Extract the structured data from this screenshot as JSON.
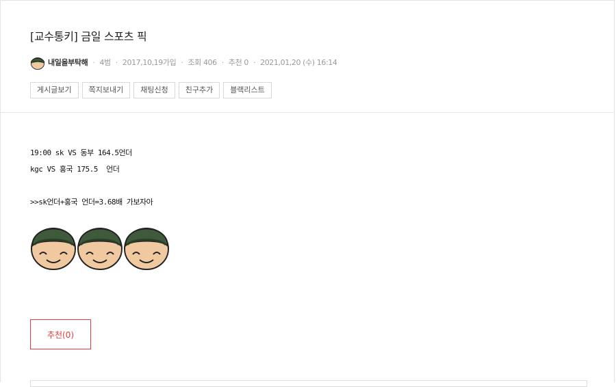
{
  "post": {
    "title": "[교수통키] 금일 스포츠 픽",
    "author": "내일을부탁해",
    "level": "4범",
    "joined": "2017,10,19가입",
    "views": "조회 406",
    "likes": "추천 0",
    "date": "2021,01,20 (수) 16:14"
  },
  "actions": [
    "게시글보기",
    "쪽지보내기",
    "채팅신청",
    "친구추가",
    "블랙리스트"
  ],
  "content": {
    "line1": "19:00 sk VS 동부 164.5언더",
    "line2": "kgc VS 홍국 175.5  언더",
    "line3": ">>sk언더+홍국 언더=3.68배 가보자아"
  },
  "recommend_label": "추천(0)",
  "icons": {
    "avatar": "soldier-avatar-icon",
    "emoji": "smiling-soldier-emoji"
  },
  "colors": {
    "accent": "#e23c3c",
    "helmet": "#3f5a3a",
    "skin": "#f1c9a1"
  }
}
